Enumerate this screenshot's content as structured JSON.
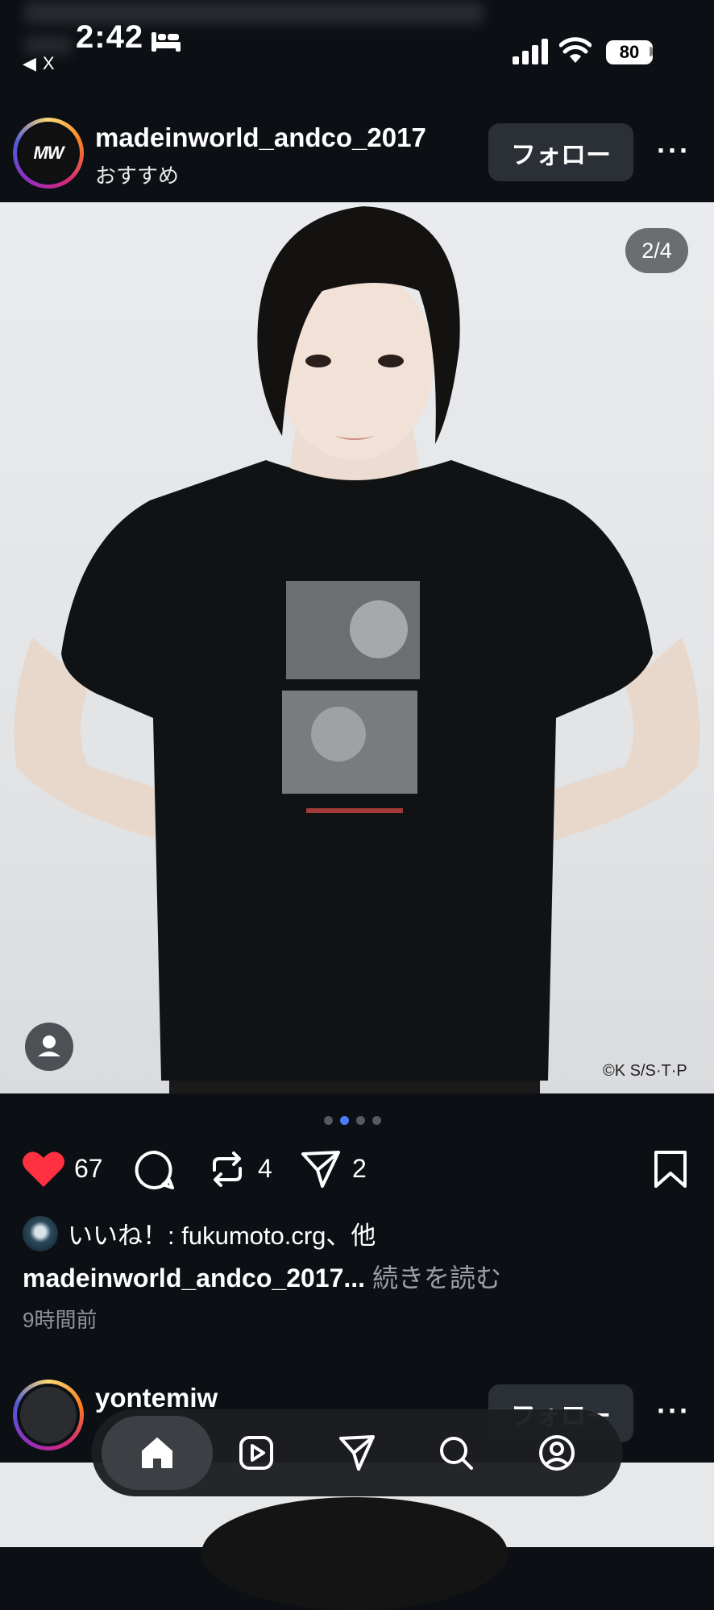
{
  "status_bar": {
    "time": "2:42",
    "back_label": "X",
    "battery": "80"
  },
  "post": {
    "username": "madeinworld_andco_2017",
    "subtitle": "おすすめ",
    "avatar_text": "MW",
    "follow_label": "フォロー",
    "image_counter": "2/4",
    "copyright": "©K S/S·T·P",
    "carousel": {
      "total": 4,
      "active_index": 1
    },
    "like_count": "67",
    "repost_count": "4",
    "share_count": "2",
    "likes_text": "いいね！: fukumoto.crg、他",
    "caption_user": "madeinworld_andco_2017...",
    "caption_more": "続きを読む",
    "time_ago": "9時間前"
  },
  "next_post": {
    "username": "yontemiw",
    "follow_label": "フォロー"
  },
  "colors": {
    "background": "#0c1014",
    "like_red": "#ff3040",
    "active_dot": "#4a7cf7"
  },
  "nav": {
    "items": [
      "home-icon",
      "reels-icon",
      "send-icon",
      "search-icon",
      "profile-icon"
    ],
    "active": "home-icon"
  }
}
